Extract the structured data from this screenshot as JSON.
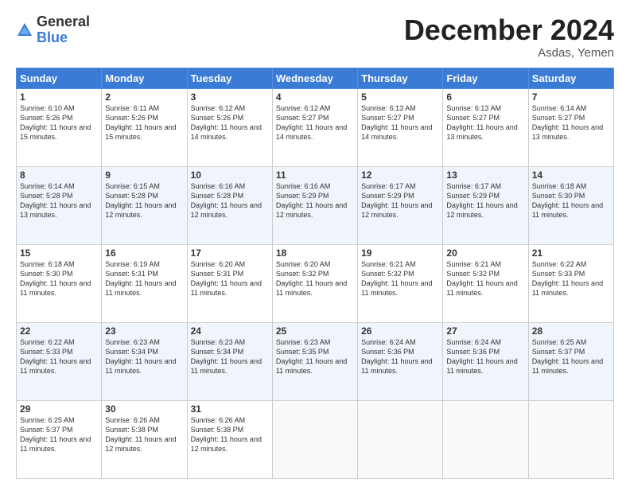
{
  "logo": {
    "general": "General",
    "blue": "Blue"
  },
  "header": {
    "month_year": "December 2024",
    "location": "Asdas, Yemen"
  },
  "days_of_week": [
    "Sunday",
    "Monday",
    "Tuesday",
    "Wednesday",
    "Thursday",
    "Friday",
    "Saturday"
  ],
  "weeks": [
    [
      {
        "day": "1",
        "sunrise": "6:10 AM",
        "sunset": "5:26 PM",
        "daylight": "11 hours and 15 minutes."
      },
      {
        "day": "2",
        "sunrise": "6:11 AM",
        "sunset": "5:26 PM",
        "daylight": "11 hours and 15 minutes."
      },
      {
        "day": "3",
        "sunrise": "6:12 AM",
        "sunset": "5:26 PM",
        "daylight": "11 hours and 14 minutes."
      },
      {
        "day": "4",
        "sunrise": "6:12 AM",
        "sunset": "5:27 PM",
        "daylight": "11 hours and 14 minutes."
      },
      {
        "day": "5",
        "sunrise": "6:13 AM",
        "sunset": "5:27 PM",
        "daylight": "11 hours and 14 minutes."
      },
      {
        "day": "6",
        "sunrise": "6:13 AM",
        "sunset": "5:27 PM",
        "daylight": "11 hours and 13 minutes."
      },
      {
        "day": "7",
        "sunrise": "6:14 AM",
        "sunset": "5:27 PM",
        "daylight": "11 hours and 13 minutes."
      }
    ],
    [
      {
        "day": "8",
        "sunrise": "6:14 AM",
        "sunset": "5:28 PM",
        "daylight": "11 hours and 13 minutes."
      },
      {
        "day": "9",
        "sunrise": "6:15 AM",
        "sunset": "5:28 PM",
        "daylight": "11 hours and 12 minutes."
      },
      {
        "day": "10",
        "sunrise": "6:16 AM",
        "sunset": "5:28 PM",
        "daylight": "11 hours and 12 minutes."
      },
      {
        "day": "11",
        "sunrise": "6:16 AM",
        "sunset": "5:29 PM",
        "daylight": "11 hours and 12 minutes."
      },
      {
        "day": "12",
        "sunrise": "6:17 AM",
        "sunset": "5:29 PM",
        "daylight": "11 hours and 12 minutes."
      },
      {
        "day": "13",
        "sunrise": "6:17 AM",
        "sunset": "5:29 PM",
        "daylight": "11 hours and 12 minutes."
      },
      {
        "day": "14",
        "sunrise": "6:18 AM",
        "sunset": "5:30 PM",
        "daylight": "11 hours and 11 minutes."
      }
    ],
    [
      {
        "day": "15",
        "sunrise": "6:18 AM",
        "sunset": "5:30 PM",
        "daylight": "11 hours and 11 minutes."
      },
      {
        "day": "16",
        "sunrise": "6:19 AM",
        "sunset": "5:31 PM",
        "daylight": "11 hours and 11 minutes."
      },
      {
        "day": "17",
        "sunrise": "6:20 AM",
        "sunset": "5:31 PM",
        "daylight": "11 hours and 11 minutes."
      },
      {
        "day": "18",
        "sunrise": "6:20 AM",
        "sunset": "5:32 PM",
        "daylight": "11 hours and 11 minutes."
      },
      {
        "day": "19",
        "sunrise": "6:21 AM",
        "sunset": "5:32 PM",
        "daylight": "11 hours and 11 minutes."
      },
      {
        "day": "20",
        "sunrise": "6:21 AM",
        "sunset": "5:32 PM",
        "daylight": "11 hours and 11 minutes."
      },
      {
        "day": "21",
        "sunrise": "6:22 AM",
        "sunset": "5:33 PM",
        "daylight": "11 hours and 11 minutes."
      }
    ],
    [
      {
        "day": "22",
        "sunrise": "6:22 AM",
        "sunset": "5:33 PM",
        "daylight": "11 hours and 11 minutes."
      },
      {
        "day": "23",
        "sunrise": "6:23 AM",
        "sunset": "5:34 PM",
        "daylight": "11 hours and 11 minutes."
      },
      {
        "day": "24",
        "sunrise": "6:23 AM",
        "sunset": "5:34 PM",
        "daylight": "11 hours and 11 minutes."
      },
      {
        "day": "25",
        "sunrise": "6:23 AM",
        "sunset": "5:35 PM",
        "daylight": "11 hours and 11 minutes."
      },
      {
        "day": "26",
        "sunrise": "6:24 AM",
        "sunset": "5:36 PM",
        "daylight": "11 hours and 11 minutes."
      },
      {
        "day": "27",
        "sunrise": "6:24 AM",
        "sunset": "5:36 PM",
        "daylight": "11 hours and 11 minutes."
      },
      {
        "day": "28",
        "sunrise": "6:25 AM",
        "sunset": "5:37 PM",
        "daylight": "11 hours and 11 minutes."
      }
    ],
    [
      {
        "day": "29",
        "sunrise": "6:25 AM",
        "sunset": "5:37 PM",
        "daylight": "11 hours and 11 minutes."
      },
      {
        "day": "30",
        "sunrise": "6:26 AM",
        "sunset": "5:38 PM",
        "daylight": "11 hours and 12 minutes."
      },
      {
        "day": "31",
        "sunrise": "6:26 AM",
        "sunset": "5:38 PM",
        "daylight": "11 hours and 12 minutes."
      },
      null,
      null,
      null,
      null
    ]
  ]
}
